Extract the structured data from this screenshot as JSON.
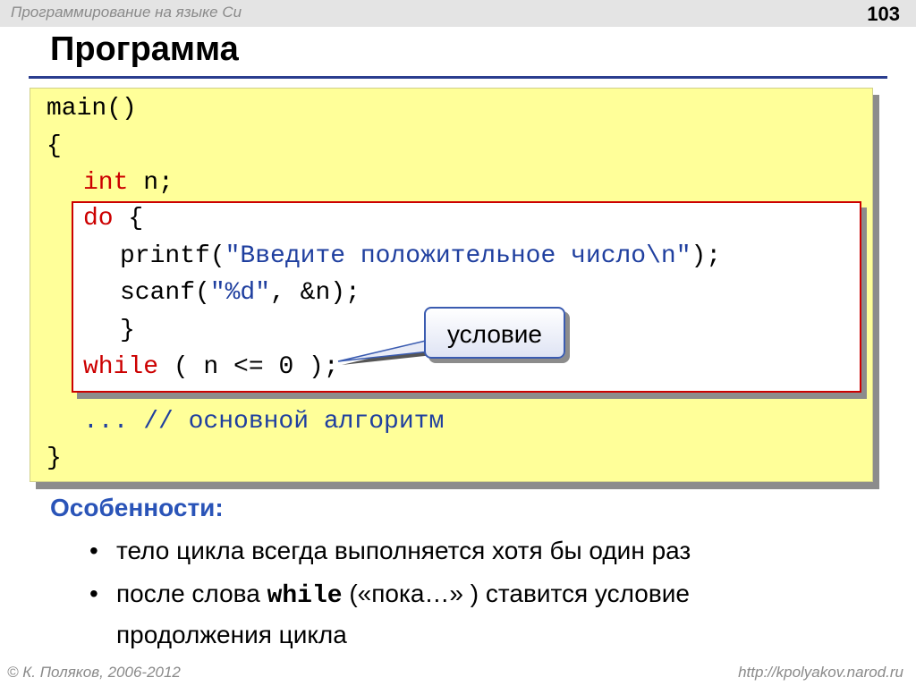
{
  "header": {
    "course": "Программирование на языке Си",
    "slide_number": "103"
  },
  "title": "Программа",
  "code": {
    "line1": "main()",
    "line2": "{",
    "line3_kw": "int",
    "line3_rest": " n;",
    "do_kw": "do",
    "do_rest": " {",
    "printf_pre": "printf(",
    "printf_str": "\"Введите положительное число\\n\"",
    "printf_post": ");",
    "scanf_pre": "scanf(",
    "scanf_str": "\"%d\"",
    "scanf_post": ", &n);",
    "close_brace": "}",
    "while_kw": "while",
    "while_rest": " ( n <= 0 );",
    "algo": "... // основной алгоритм",
    "end_brace": "}"
  },
  "callout": {
    "label": "условие"
  },
  "features": {
    "title": "Особенности:",
    "bullet1": "тело цикла всегда выполняется хотя бы один раз",
    "bullet2_pre": "после слова ",
    "bullet2_code": "while",
    "bullet2_post": " («пока…» ) ставится условие",
    "bullet2_line2": "продолжения цикла"
  },
  "footer": {
    "author": "© К. Поляков, 2006-2012",
    "url": "http://kpolyakov.narod.ru"
  },
  "colors": {
    "title_rule": "#2a3d8f",
    "code_bg": "#ffff99",
    "keyword": "#cc0000",
    "string": "#1f3f9f",
    "features_title": "#2a54b8"
  }
}
